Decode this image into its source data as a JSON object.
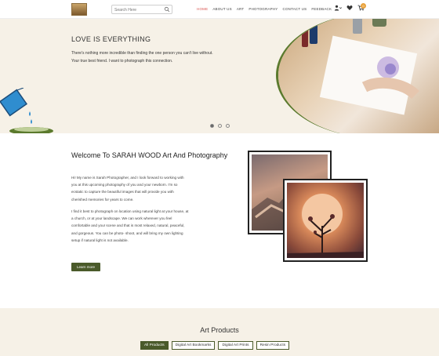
{
  "header": {
    "search_placeholder": "Search Here",
    "nav": [
      "HOME",
      "ABOUT US",
      "ART",
      "PHOTOGRAPHY",
      "CONTACT US",
      "FEEDBACK"
    ],
    "active_nav": "HOME",
    "cart_count": "0"
  },
  "hero": {
    "title": "LOVE IS EVERYTHING",
    "text": "There's nothing more incredible than finding the one person you can't live without. Your true best friend. I want to photograph this connection.",
    "slide_count": 3,
    "active_slide": 1
  },
  "welcome": {
    "title": "Welcome To SARAH WOOD Art And Photography",
    "para1": "Hi! My name is Sarah Photographer, and I look forward to working with you at this upcoming photography of you and your newborn. I'm so ecstatic to capture the beautiful images that will provide you with cherished memories for years to come.",
    "para2": "I find it best to photograph on location using natural light at your house, at a church, or at your landscape. We can work wherever you feel comfortable and your scene and that is most relaxed, natural, peaceful, and gorgeous. You can be photo- shoot, and will bring my own lighting setup if natural light is not available.",
    "button": "Learn more"
  },
  "products": {
    "title": "Art Products",
    "tabs": [
      "All Products",
      "Digital Art Bookmarks",
      "Digital Art Prints",
      "Resin Products"
    ],
    "active_tab": "All Products"
  },
  "colors": {
    "accent_green": "#4a5a2a",
    "active_nav": "#d9534f",
    "cream": "#f6f1e7"
  }
}
